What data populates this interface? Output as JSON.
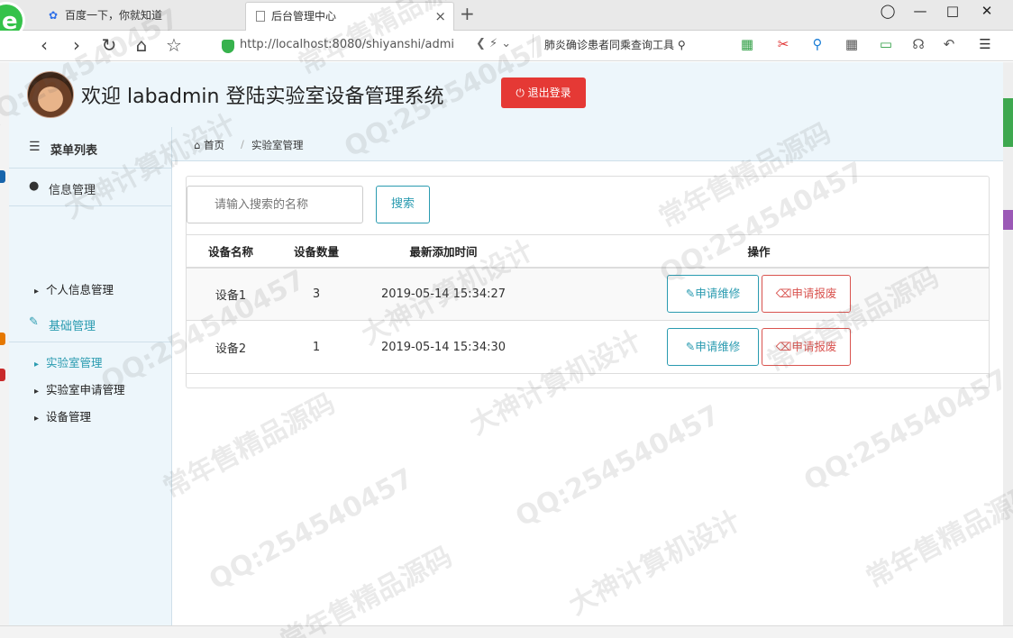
{
  "browser": {
    "tabs": [
      {
        "label": "百度一下，你就知道",
        "active": false
      },
      {
        "label": "后台管理中心",
        "active": true
      }
    ],
    "address": "http://localhost:8080/shiyanshi/admi",
    "search_text": "肺炎确诊患者同乘查询工具"
  },
  "header": {
    "welcome": "欢迎 labadmin 登陆实验室设备管理系统",
    "logout_label": "退出登录"
  },
  "sidebar": {
    "title": "菜单列表",
    "groups": [
      {
        "label": "信息管理",
        "items": [
          "个人信息管理"
        ]
      },
      {
        "label": "基础管理",
        "items": [
          "实验室管理",
          "实验室申请管理",
          "设备管理"
        ]
      }
    ]
  },
  "breadcrumb": {
    "home": "首页",
    "current": "实验室管理"
  },
  "search": {
    "placeholder": "请输入搜索的名称",
    "button": "搜索"
  },
  "table": {
    "headers": [
      "设备名称",
      "设备数量",
      "最新添加时间",
      "操作"
    ],
    "rows": [
      {
        "name": "设备1",
        "count": "3",
        "time": "2019-05-14 15:34:27",
        "repair": "申请维修",
        "scrap": "申请报废"
      },
      {
        "name": "设备2",
        "count": "1",
        "time": "2019-05-14 15:34:30",
        "repair": "申请维修",
        "scrap": "申请报废"
      }
    ]
  },
  "watermark": [
    "QQ:254540457",
    "常年售精品源码",
    "大神计算机设计"
  ],
  "colors": {
    "accent": "#2a9bb0",
    "danger": "#e53935",
    "header_bg": "#edf6fb"
  }
}
